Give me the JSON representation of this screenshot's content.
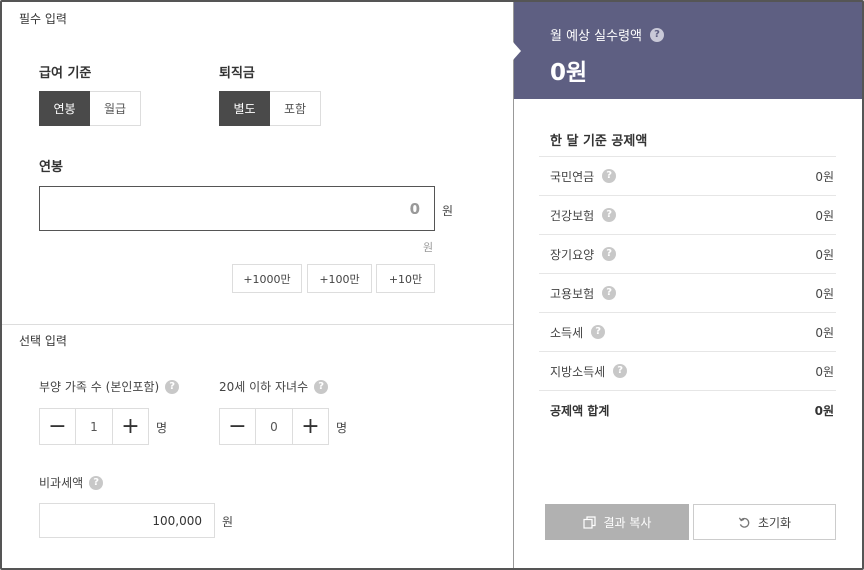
{
  "required": {
    "section_title": "필수 입력",
    "salary_basis": {
      "label": "급여 기준",
      "options": [
        "연봉",
        "월급"
      ],
      "selected": "연봉"
    },
    "severance": {
      "label": "퇴직금",
      "options": [
        "별도",
        "포함"
      ],
      "selected": "별도"
    },
    "annual": {
      "label": "연봉",
      "value": "0",
      "unit": "원",
      "sub_unit": "원"
    },
    "quick_add": [
      "+1000만",
      "+100만",
      "+10만"
    ]
  },
  "optional": {
    "section_title": "선택 입력",
    "dependents": {
      "label": "부양 가족 수 (본인포함)",
      "value": "1",
      "unit": "명"
    },
    "children": {
      "label": "20세 이하 자녀수",
      "value": "0",
      "unit": "명"
    },
    "nontaxable": {
      "label": "비과세액",
      "value": "100,000",
      "unit": "원"
    }
  },
  "result": {
    "title": "월 예상 실수령액",
    "amount": "0원",
    "deduction_title": "한 달 기준 공제액",
    "items": [
      {
        "name": "국민연금",
        "value": "0원"
      },
      {
        "name": "건강보험",
        "value": "0원"
      },
      {
        "name": "장기요양",
        "value": "0원"
      },
      {
        "name": "고용보험",
        "value": "0원"
      },
      {
        "name": "소득세",
        "value": "0원"
      },
      {
        "name": "지방소득세",
        "value": "0원"
      }
    ],
    "total": {
      "name": "공제액 합계",
      "value": "0원"
    },
    "copy_label": "결과 복사",
    "reset_label": "초기화"
  },
  "icons": {
    "help": "?",
    "minus": "−",
    "plus": "+"
  },
  "colors": {
    "header_bg": "#5e5f82",
    "active_btn": "#4a4a4a",
    "copy_btn": "#b1b1b1"
  }
}
